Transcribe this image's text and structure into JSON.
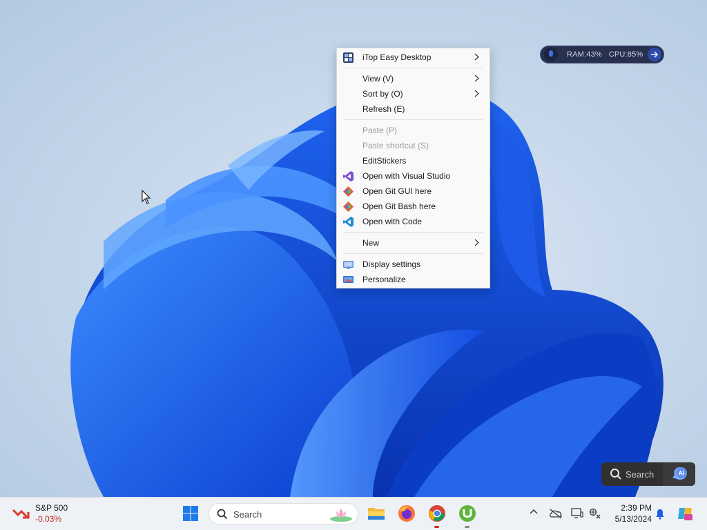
{
  "perf_widget": {
    "ram": "RAM:43%",
    "cpu": "CPU:85%"
  },
  "context_menu": {
    "items": [
      {
        "label": "iTop Easy Desktop",
        "icon": "itop-easy-desktop-icon",
        "submenu": true
      },
      {
        "label": "View (V)",
        "submenu": true
      },
      {
        "label": "Sort by (O)",
        "submenu": true
      },
      {
        "label": "Refresh (E)"
      },
      {
        "label": "Paste (P)",
        "disabled": true
      },
      {
        "label": "Paste shortcut (S)",
        "disabled": true
      },
      {
        "label": "EditStickers"
      },
      {
        "label": "Open with Visual Studio",
        "icon": "visual-studio-icon"
      },
      {
        "label": "Open Git GUI here",
        "icon": "git-gui-icon"
      },
      {
        "label": "Open Git Bash here",
        "icon": "git-bash-icon"
      },
      {
        "label": "Open with Code",
        "icon": "vscode-icon"
      },
      {
        "label": "New",
        "submenu": true
      },
      {
        "label": "Display settings",
        "icon": "display-settings-icon"
      },
      {
        "label": "Personalize",
        "icon": "personalize-icon"
      }
    ]
  },
  "floating_search": {
    "label": "Search",
    "ai_badge": "AI"
  },
  "taskbar": {
    "widget": {
      "name": "S&P 500",
      "change": "-0.03%",
      "change_color": "#c42b1c"
    },
    "search": {
      "label": "Search"
    },
    "pinned": [
      "windows-start-icon",
      "file-explorer-icon",
      "firefox-icon",
      "chrome-icon",
      "utorrent-icon"
    ],
    "clock": {
      "time": "2:39 PM",
      "date": "5/13/2024"
    }
  },
  "colors": {
    "accent": "#1f5fe0",
    "menu_bg": "#f9f9f9",
    "taskbar_bg": "#eef1f6"
  }
}
